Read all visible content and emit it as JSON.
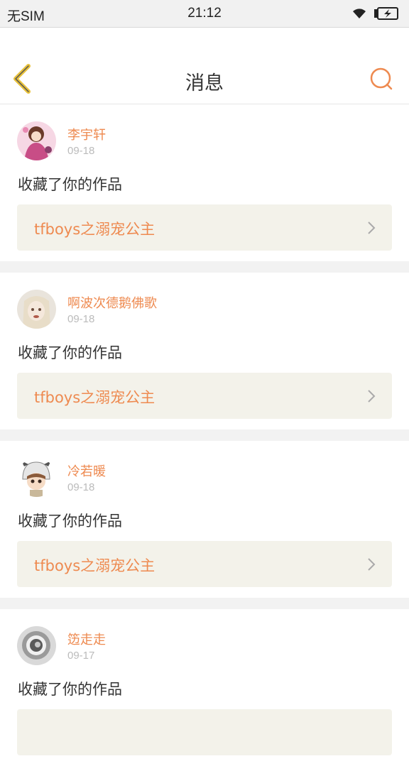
{
  "status_bar": {
    "carrier": "无SIM",
    "time": "21:12",
    "icons": [
      "wifi-icon",
      "battery-charging-icon"
    ]
  },
  "nav": {
    "title": "消息",
    "back_icon": "back-chevron-icon",
    "search_icon": "search-icon"
  },
  "colors": {
    "accent": "#ee8a50",
    "work_bg": "#f3f2ea",
    "separator": "#f2f2f2",
    "back_icon": "#e8c13a"
  },
  "messages": [
    {
      "user": "李宇轩",
      "date": "09-18",
      "action": "收藏了你的作品",
      "work": "tfboys之溺宠公主"
    },
    {
      "user": "啊波次德鹅佛歌",
      "date": "09-18",
      "action": "收藏了你的作品",
      "work": "tfboys之溺宠公主"
    },
    {
      "user": "冷若暖",
      "date": "09-18",
      "action": "收藏了你的作品",
      "work": "tfboys之溺宠公主"
    },
    {
      "user": "笾走走",
      "date": "09-17",
      "action": "收藏了你的作品",
      "work": ""
    }
  ]
}
